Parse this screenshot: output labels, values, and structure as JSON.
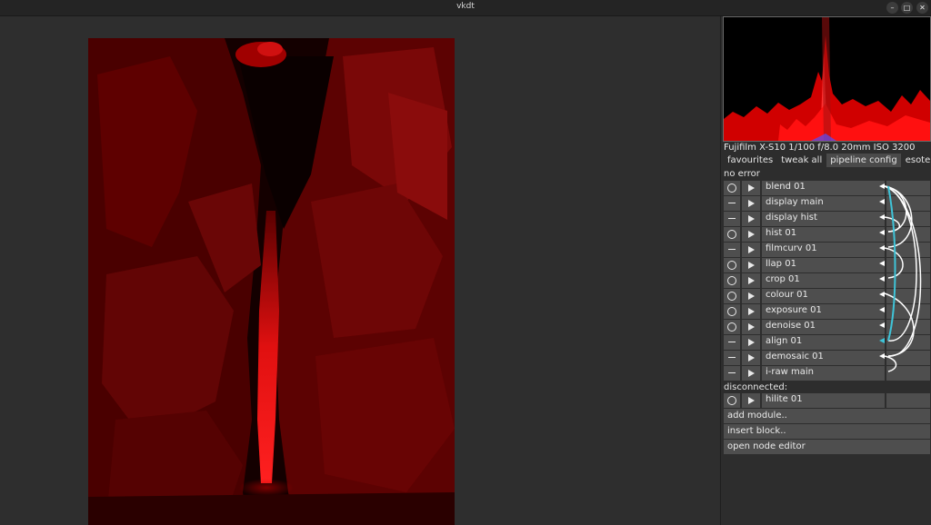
{
  "window": {
    "title": "vkdt"
  },
  "camera_info": "Fujifilm X-S10 1/100 f/8.0 20mm ISO 3200",
  "tabs": [
    {
      "label": "favourites",
      "active": false
    },
    {
      "label": "tweak all",
      "active": false
    },
    {
      "label": "pipeline config",
      "active": true
    },
    {
      "label": "esoteric",
      "active": false
    }
  ],
  "status": "no error",
  "modules": [
    {
      "label": "blend 01",
      "state": "circle"
    },
    {
      "label": "display main",
      "state": "dash"
    },
    {
      "label": "display hist",
      "state": "dash"
    },
    {
      "label": "hist 01",
      "state": "circle"
    },
    {
      "label": "filmcurv 01",
      "state": "dash"
    },
    {
      "label": "llap 01",
      "state": "circle"
    },
    {
      "label": "crop 01",
      "state": "circle"
    },
    {
      "label": "colour 01",
      "state": "circle"
    },
    {
      "label": "exposure 01",
      "state": "circle"
    },
    {
      "label": "denoise 01",
      "state": "circle"
    },
    {
      "label": "align 01",
      "state": "dash"
    },
    {
      "label": "demosaic 01",
      "state": "dash"
    },
    {
      "label": "i-raw main",
      "state": "dash"
    }
  ],
  "disconnected_label": "disconnected:",
  "disconnected_modules": [
    {
      "label": "hilite 01",
      "state": "circle"
    }
  ],
  "actions": {
    "add_module": "add module..",
    "insert_block": "insert block..",
    "open_node_editor": "open node editor"
  },
  "colors": {
    "wire_white": "#ffffff",
    "wire_cyan": "#3fc4d8",
    "image_red": "#c00000"
  }
}
